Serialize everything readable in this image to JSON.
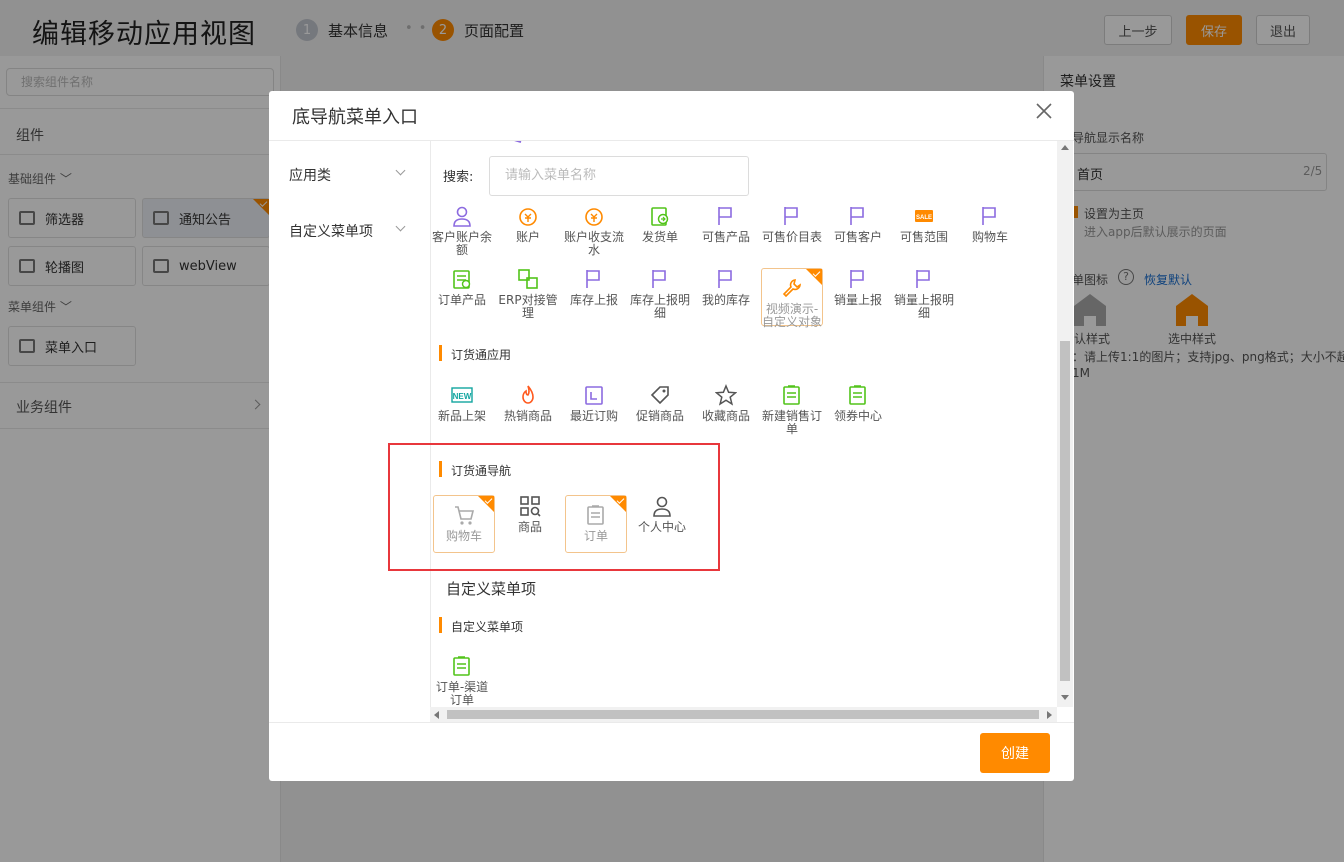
{
  "header": {
    "title": "编辑移动应用视图",
    "step1": {
      "num": "1",
      "label": "基本信息"
    },
    "step_dots": "• •",
    "step2": {
      "num": "2",
      "label": "页面配置"
    },
    "prev_label": "上一步",
    "save_label": "保存",
    "exit_label": "退出"
  },
  "left": {
    "search_placeholder": "搜索组件名称",
    "components_title": "组件",
    "basic_title": "基础组件",
    "basic_items": [
      "筛选器",
      "通知公告",
      "轮播图",
      "webView"
    ],
    "menu_title": "菜单组件",
    "menu_items": [
      "菜单入口"
    ],
    "business_title": "业务组件"
  },
  "right": {
    "title": "菜单设置",
    "nav_name_label": "导航显示名称",
    "nav_name_value": "首页",
    "nav_name_count": "2/5",
    "homepage_label": "设置为主页",
    "homepage_hint": "进入app后默认展示的页面",
    "icon_label": "单图标",
    "restore_label": "恢复默认",
    "default_style": "认样式",
    "selected_style": "选中样式",
    "upload_hint": "：请上传1:1的图片；支持jpg、png格式；大小不超",
    "upload_hint2": "1M"
  },
  "modal": {
    "title": "底导航菜单入口",
    "categories": [
      "应用类",
      "自定义菜单项"
    ],
    "search_label": "搜索:",
    "search_placeholder": "请输入菜单名称",
    "row1": [
      "客户账户余额",
      "账户",
      "账户收支流水",
      "发货单",
      "可售产品",
      "可售价目表",
      "可售客户",
      "可售范围",
      "购物车"
    ],
    "row2": [
      "订单产品",
      "ERP对接管理",
      "库存上报",
      "库存上报明细",
      "我的库存",
      "视频演示-自定义对象",
      "销量上报",
      "销量上报明细"
    ],
    "group_app_title": "订货通应用",
    "group_app": [
      "新品上架",
      "热销商品",
      "最近订购",
      "促销商品",
      "收藏商品",
      "新建销售订单",
      "领券中心"
    ],
    "group_nav_title": "订货通导航",
    "group_nav": [
      "购物车",
      "商品",
      "订单",
      "个人中心"
    ],
    "custom_section_title": "自定义菜单项",
    "custom_group_title": "自定义菜单项",
    "custom_items": [
      "订单-渠道订单"
    ],
    "create_label": "创建"
  },
  "colors": {
    "accent": "#ff8a00",
    "highlight_box": "#e8373c",
    "purple_icon": "#8c6be0",
    "green_icon": "#52c41a"
  }
}
